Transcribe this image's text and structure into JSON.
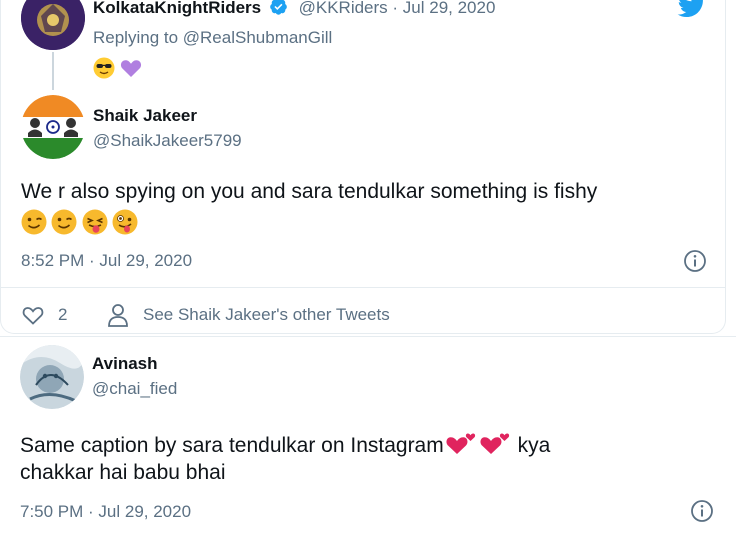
{
  "reply_parent": {
    "name": "KolkataKnightRiders",
    "handle": "@KKRiders",
    "date": "Jul 29, 2020",
    "replying_to": "Replying to @RealShubmanGill",
    "emojis": [
      "smiling-face-with-sunglasses",
      "purple-heart"
    ]
  },
  "tweet_main": {
    "name": "Shaik Jakeer",
    "handle": "@ShaikJakeer5799",
    "text": "We r also spying on you and sara tendulkar something is fishy",
    "emojis": [
      "winking-face",
      "winking-face",
      "face-with-tongue",
      "zany-face"
    ],
    "timestamp": "8:52 PM · Jul 29, 2020",
    "like_count": "2",
    "see_other": "See Shaik Jakeer's other Tweets"
  },
  "tweet_second": {
    "name": "Avinash",
    "handle": "@chai_fied",
    "text_part1": "Same caption by sara tendulkar on Instagram",
    "text_part2": " kya",
    "text_line2": "chakkar hai babu bhai",
    "emojis": [
      "two-hearts",
      "two-hearts"
    ],
    "timestamp": "7:50 PM · Jul 29, 2020"
  },
  "colors": {
    "twitter_blue": "#1da1f2",
    "text_muted": "#5b7083",
    "verified_blue": "#1da1f2",
    "purple_heart": "#b07fe0",
    "kkr_purple": "#3a2266"
  }
}
